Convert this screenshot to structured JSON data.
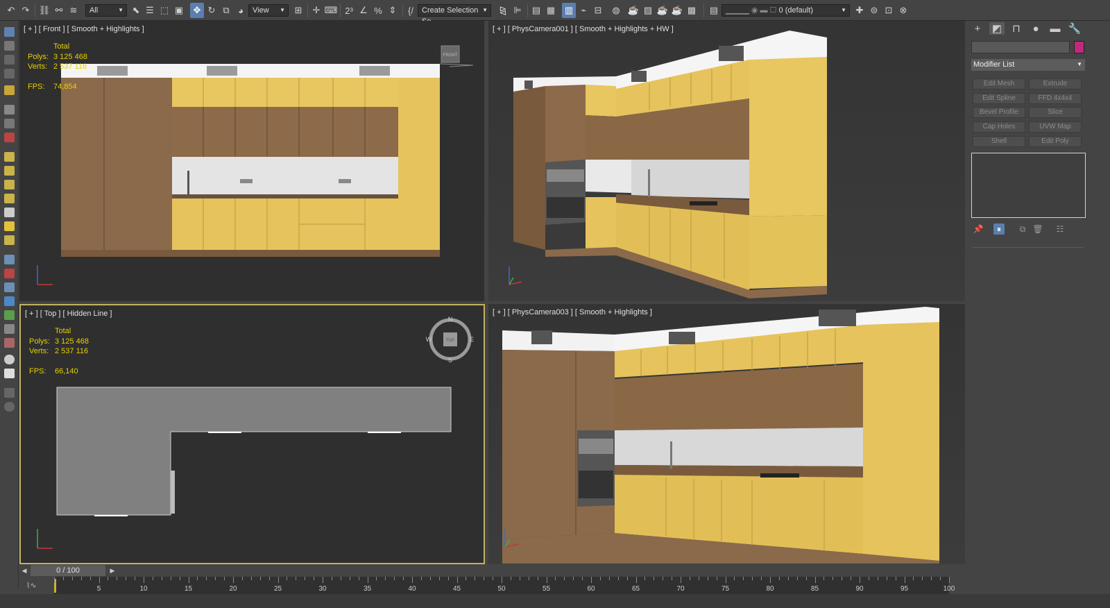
{
  "toolbar": {
    "selection_filter": "All",
    "ref_coord": "View",
    "named_selection": "Create Selection Se",
    "layer": "0 (default)"
  },
  "viewports": {
    "front": {
      "label": "[ + ] [ Front ] [ Smooth + Highlights ]",
      "stats": {
        "total_label": "Total",
        "polys_label": "Polys:",
        "polys": "3 125 468",
        "verts_label": "Verts:",
        "verts": "2 537 116",
        "fps_label": "FPS:",
        "fps": "74,854"
      },
      "viewcube_label": "FRONT"
    },
    "cam1": {
      "label": "[ + ] [ PhysCamera001 ] [ Smooth + Highlights + HW ]"
    },
    "top": {
      "label": "[ + ] [ Top ] [ Hidden Line ]",
      "stats": {
        "total_label": "Total",
        "polys_label": "Polys:",
        "polys": "3 125 468",
        "verts_label": "Verts:",
        "verts": "2 537 116",
        "fps_label": "FPS:",
        "fps": "66,140"
      },
      "viewcube_label": "TOP",
      "compass": {
        "n": "N",
        "s": "S",
        "e": "E",
        "w": "W"
      }
    },
    "cam3": {
      "label": "[ + ] [ PhysCamera003 ] [ Smooth + Highlights ]"
    },
    "axis": {
      "x": "x",
      "y": "y",
      "z": "z"
    }
  },
  "command_panel": {
    "modifier_list": "Modifier List",
    "buttons": [
      "Edit Mesh",
      "Extrude",
      "Edit Spline",
      "FFD 4x4x4",
      "Bevel Profile",
      "Slice",
      "Cap Holes",
      "UVW Map",
      "Shell",
      "Edit Poly"
    ]
  },
  "timeline": {
    "frame": "0 / 100",
    "ticks": [
      "5",
      "10",
      "15",
      "20",
      "25",
      "30",
      "35",
      "40",
      "45",
      "50",
      "55",
      "60",
      "65",
      "70",
      "75",
      "80",
      "85",
      "90",
      "95",
      "100"
    ]
  },
  "colors": {
    "accent": "#5b7fae",
    "stats": "#e8d000",
    "active_border": "#c2b361",
    "swatch": "#c0297f",
    "cabinet_yellow": "#e4c45a",
    "wood": "#8a6a4a"
  }
}
